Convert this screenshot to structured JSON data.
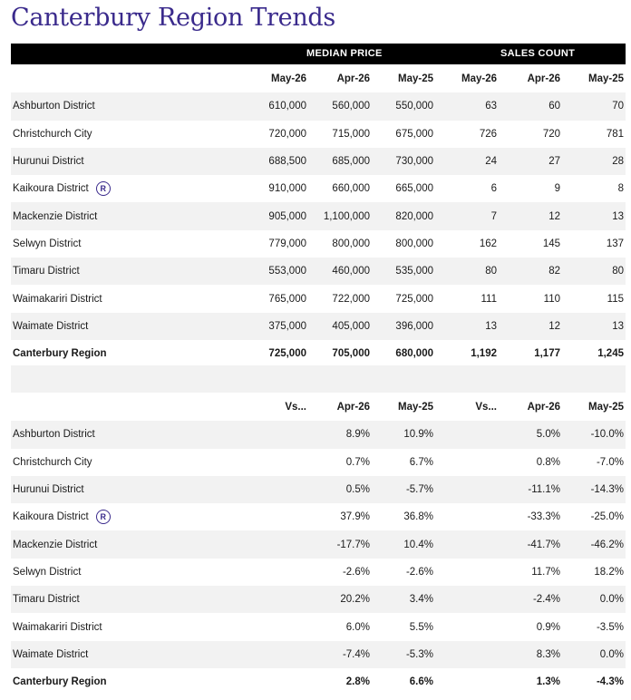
{
  "title": "Canterbury Region Trends",
  "group_headers": {
    "median_price": "MEDIAN PRICE",
    "sales_count": "SALES COUNT"
  },
  "top_columns": [
    "May-26",
    "Apr-26",
    "May-25",
    "May-26",
    "Apr-26",
    "May-25"
  ],
  "top_rows": [
    {
      "name": "Ashburton District",
      "values": [
        "610,000",
        "560,000",
        "550,000",
        "63",
        "60",
        "70"
      ]
    },
    {
      "name": "Christchurch City",
      "values": [
        "720,000",
        "715,000",
        "675,000",
        "726",
        "720",
        "781"
      ]
    },
    {
      "name": "Hurunui District",
      "values": [
        "688,500",
        "685,000",
        "730,000",
        "24",
        "27",
        "28"
      ]
    },
    {
      "name": "Kaikoura District",
      "badge": "R",
      "values": [
        "910,000",
        "660,000",
        "665,000",
        "6",
        "9",
        "8"
      ]
    },
    {
      "name": "Mackenzie District",
      "values": [
        "905,000",
        "1,100,000",
        "820,000",
        "7",
        "12",
        "13"
      ]
    },
    {
      "name": "Selwyn District",
      "values": [
        "779,000",
        "800,000",
        "800,000",
        "162",
        "145",
        "137"
      ]
    },
    {
      "name": "Timaru District",
      "values": [
        "553,000",
        "460,000",
        "535,000",
        "80",
        "82",
        "80"
      ]
    },
    {
      "name": "Waimakariri District",
      "values": [
        "765,000",
        "722,000",
        "725,000",
        "111",
        "110",
        "115"
      ]
    },
    {
      "name": "Waimate District",
      "values": [
        "375,000",
        "405,000",
        "396,000",
        "13",
        "12",
        "13"
      ]
    },
    {
      "name": "Canterbury Region",
      "values": [
        "725,000",
        "705,000",
        "680,000",
        "1,192",
        "1,177",
        "1,245"
      ]
    }
  ],
  "bottom_columns": [
    "Vs...",
    "Apr-26",
    "May-25",
    "Vs...",
    "Apr-26",
    "May-25"
  ],
  "bottom_rows": [
    {
      "name": "Ashburton District",
      "values": [
        "",
        "8.9%",
        "10.9%",
        "",
        "5.0%",
        "-10.0%"
      ]
    },
    {
      "name": "Christchurch City",
      "values": [
        "",
        "0.7%",
        "6.7%",
        "",
        "0.8%",
        "-7.0%"
      ]
    },
    {
      "name": "Hurunui District",
      "values": [
        "",
        "0.5%",
        "-5.7%",
        "",
        "-11.1%",
        "-14.3%"
      ]
    },
    {
      "name": "Kaikoura District",
      "badge": "R",
      "values": [
        "",
        "37.9%",
        "36.8%",
        "",
        "-33.3%",
        "-25.0%"
      ]
    },
    {
      "name": "Mackenzie District",
      "values": [
        "",
        "-17.7%",
        "10.4%",
        "",
        "-41.7%",
        "-46.2%"
      ]
    },
    {
      "name": "Selwyn District",
      "values": [
        "",
        "-2.6%",
        "-2.6%",
        "",
        "11.7%",
        "18.2%"
      ]
    },
    {
      "name": "Timaru District",
      "values": [
        "",
        "20.2%",
        "3.4%",
        "",
        "-2.4%",
        "0.0%"
      ]
    },
    {
      "name": "Waimakariri District",
      "values": [
        "",
        "6.0%",
        "5.5%",
        "",
        "0.9%",
        "-3.5%"
      ]
    },
    {
      "name": "Waimate District",
      "values": [
        "",
        "-7.4%",
        "-5.3%",
        "",
        "8.3%",
        "0.0%"
      ]
    },
    {
      "name": "Canterbury Region",
      "values": [
        "",
        "2.8%",
        "6.6%",
        "",
        "1.3%",
        "-4.3%"
      ]
    }
  ]
}
